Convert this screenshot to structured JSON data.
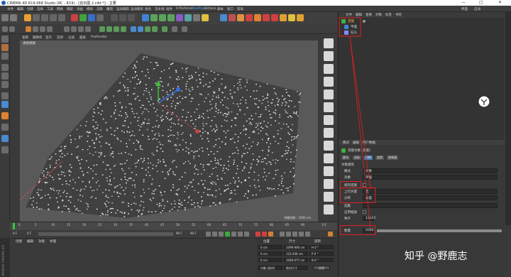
{
  "window": {
    "title": "CINEMA 4D R19.068 Studio (RC - R19) - [岩石图 2.c4d *] - 主要",
    "controls": [
      "—",
      "□",
      "✕"
    ]
  },
  "menu": {
    "items": [
      "文件",
      "编辑",
      "创建",
      "选择",
      "工具",
      "网格",
      "捕捉",
      "动画",
      "模拟",
      "渲染",
      "雕刻",
      "运动跟踪",
      "运动图形",
      "角色",
      "流水线",
      "插件",
      "X-Particles",
      "RealFlow",
      "Octane",
      "脚本",
      "窗口",
      "帮助"
    ],
    "right": [
      "界面",
      "启动"
    ]
  },
  "viewport": {
    "menu": [
      "查看",
      "摄像机",
      "显示",
      "选项",
      "过滤",
      "面板",
      "ProRender"
    ],
    "label": "透视视图",
    "stamp": "网格间距：1000 cm"
  },
  "timeline": {
    "ticks": [
      "0",
      "5",
      "10",
      "15",
      "20",
      "25",
      "30",
      "35",
      "40",
      "45",
      "50",
      "55",
      "60",
      "65",
      "70",
      "75",
      "80",
      "85",
      "90"
    ],
    "frame_end": "90 F",
    "frame": "0 F"
  },
  "transport": {
    "start": "0 F",
    "current": "0 F",
    "end": "90 F",
    "end2": "90 F"
  },
  "material": {
    "menu": [
      "创建",
      "编辑",
      "功能",
      "纹理"
    ]
  },
  "coords": {
    "headers": [
      "位置",
      "尺寸",
      "旋转"
    ],
    "rows": [
      {
        "pos": "0 cm",
        "size": "1099.906 cm",
        "rot": "H 0 °"
      },
      {
        "pos": "0 cm",
        "size": "122.446 cm",
        "rot": "P 0 °"
      },
      {
        "pos": "0 cm",
        "size": "1099.677 cm",
        "rot": "B 0 °"
      }
    ],
    "mode": "对象 (相对)",
    "mode2": "绝对尺寸",
    "apply": "应用"
  },
  "maxon": "MAXON CINEMA 4D",
  "object_manager": {
    "tabs": [
      "文件",
      "编辑",
      "查看",
      "对象",
      "标签",
      "书签"
    ],
    "objects": [
      {
        "name": "克隆",
        "icon": "cloner-icon"
      },
      {
        "name": "平面",
        "icon": "plane-icon"
      },
      {
        "name": "石头",
        "icon": "stone-icon"
      }
    ]
  },
  "attribute_manager": {
    "tabs": [
      "模式",
      "编辑",
      "用户数据"
    ],
    "object_title": "克隆对象 [克隆]",
    "sub_tabs": [
      "基本",
      "坐标",
      "对象",
      "变换",
      "效果器"
    ],
    "section": "对象属性",
    "rows": [
      {
        "label": "模式",
        "value": "对象"
      },
      {
        "label": "对象",
        "value": "平面"
      },
      {
        "label": "排列克隆",
        "value": ""
      },
      {
        "label": "上行矢量",
        "value": "无"
      },
      {
        "label": "分布",
        "value": "表面"
      },
      {
        "label": "选集",
        "value": ""
      },
      {
        "label": "启用缩放",
        "value": ""
      },
      {
        "label": "种子",
        "value": "12345"
      },
      {
        "label": "数量",
        "value": "5000"
      }
    ]
  },
  "watermark": "知乎 @野鹿志"
}
